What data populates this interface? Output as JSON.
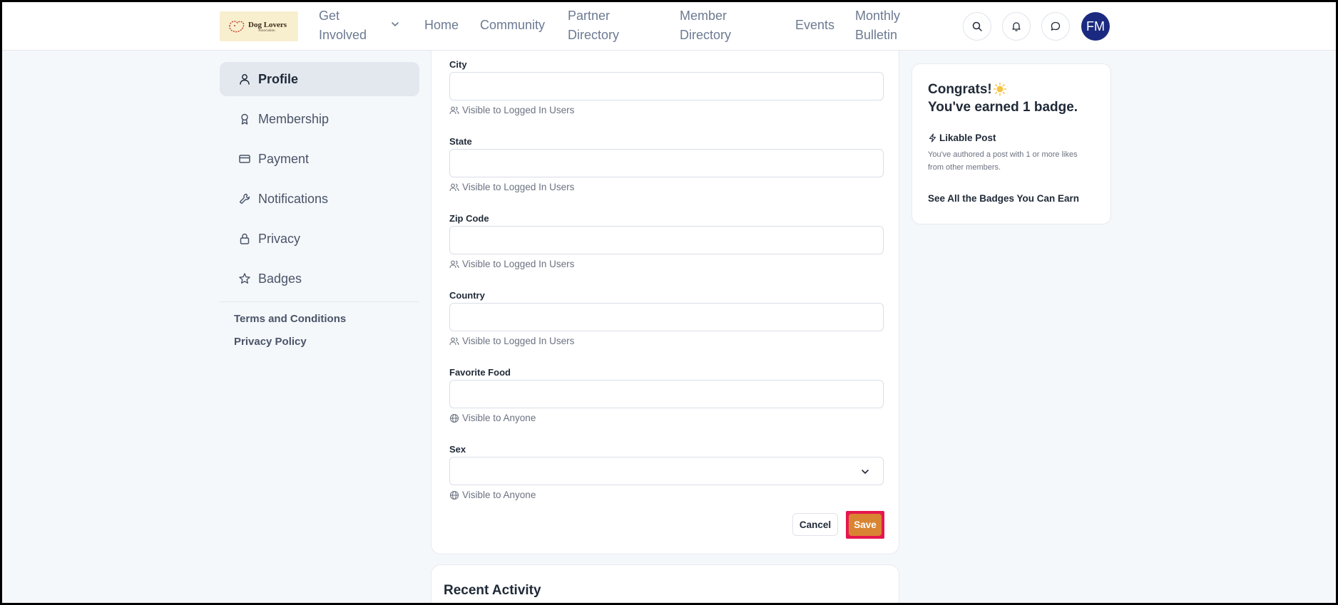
{
  "header": {
    "logo_text": "Dog Lovers",
    "logo_subtext": "Association",
    "nav": [
      {
        "label_line1": "Get",
        "label_line2": "Involved"
      },
      {
        "label": "Home"
      },
      {
        "label": "Community"
      },
      {
        "label_line1": "Partner",
        "label_line2": "Directory"
      },
      {
        "label_line1": "Member",
        "label_line2": "Directory"
      },
      {
        "label": "Events"
      },
      {
        "label_line1": "Monthly",
        "label_line2": "Bulletin"
      }
    ],
    "avatar_initials": "FM"
  },
  "sidebar": {
    "items": [
      {
        "label": "Profile",
        "icon": "user-icon",
        "active": true
      },
      {
        "label": "Membership",
        "icon": "award-icon"
      },
      {
        "label": "Payment",
        "icon": "credit-card-icon"
      },
      {
        "label": "Notifications",
        "icon": "wrench-icon"
      },
      {
        "label": "Privacy",
        "icon": "lock-icon"
      },
      {
        "label": "Badges",
        "icon": "star-icon"
      }
    ],
    "links": [
      "Terms and Conditions",
      "Privacy Policy"
    ]
  },
  "form": {
    "fields": [
      {
        "label": "City",
        "value": "",
        "visibility": "Visible to Logged In Users"
      },
      {
        "label": "State",
        "value": "",
        "visibility": "Visible to Logged In Users"
      },
      {
        "label": "Zip Code",
        "value": "",
        "visibility": "Visible to Logged In Users"
      },
      {
        "label": "Country",
        "value": "",
        "visibility": "Visible to Logged In Users"
      },
      {
        "label": "Favorite Food",
        "value": "",
        "visibility": "Visible to Anyone"
      },
      {
        "label": "Sex",
        "value": "",
        "visibility": "Visible to Anyone",
        "type": "select"
      }
    ],
    "cancel_label": "Cancel",
    "save_label": "Save"
  },
  "recent_activity": {
    "title": "Recent Activity"
  },
  "badges": {
    "congrats_line1": "Congrats!",
    "congrats_line2": "You've earned 1 badge.",
    "badge_name": "Likable Post",
    "badge_desc": "You've authored a post with 1 or more likes from other members.",
    "see_all": "See All the Badges You Can Earn"
  },
  "colors": {
    "accent": "#d98432",
    "highlight": "#e6164f",
    "avatar": "#1b2a80"
  }
}
